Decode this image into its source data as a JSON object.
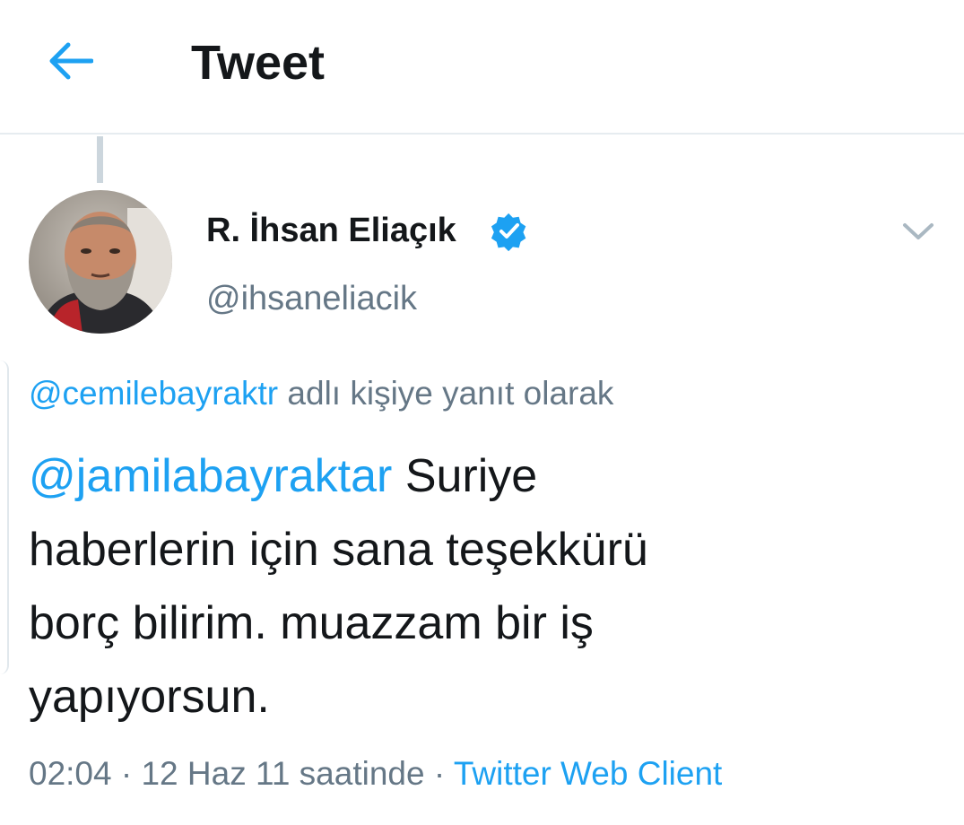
{
  "header": {
    "title": "Tweet",
    "back_icon": "arrow-left-icon",
    "accent_color": "#1da1f2"
  },
  "tweet": {
    "author": {
      "display_name": "R. İhsan Eliaçık",
      "handle": "@ihsaneliacik",
      "verified": true,
      "verified_icon": "verified-badge-icon"
    },
    "reply_context": {
      "mention": "@cemilebayraktr",
      "suffix": "adlı kişiye yanıt olarak"
    },
    "body": {
      "mention": "@jamilabayraktar",
      "line1_rest": "Suriye",
      "line2": "haberlerin için sana teşekkürü",
      "line3": "borç bilirim. muazzam bir iş",
      "line4": "yapıyorsun."
    },
    "meta": {
      "time": "02:04",
      "separator": "·",
      "date": "12 Haz 11 saatinde",
      "separator2": "·",
      "source": "Twitter Web Client"
    },
    "caret_icon": "chevron-down-icon"
  }
}
